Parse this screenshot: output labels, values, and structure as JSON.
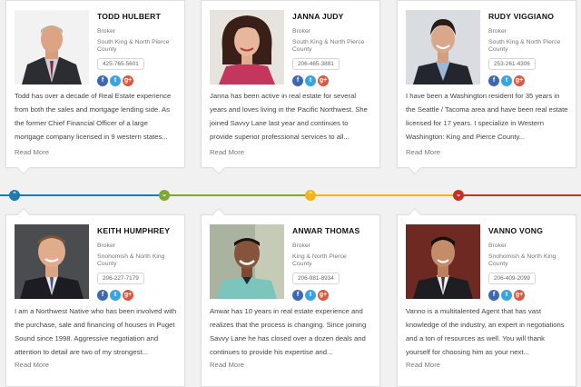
{
  "labels": {
    "read_more": "Read More",
    "fb": "f",
    "tw": "t",
    "gp": "g+"
  },
  "timeline": {
    "colors": {
      "blue": "#1f79b3",
      "green": "#7da933",
      "yellow": "#f3b51b",
      "red": "#c63026"
    },
    "icons": [
      "chevron-up-icon",
      "chevron-down-icon",
      "chevron-up-icon",
      "chevron-down-icon"
    ]
  },
  "agents": [
    {
      "name": "TODD HULBERT",
      "role": "Broker",
      "area": "South King & North Pierce County",
      "phone": "425-765-5601",
      "bio": "Todd has over a decade of Real Estate experience from both the sales and mortgage lending side. As the former Chief Financial Officer of a large mortgage company licensed in 9 western states..."
    },
    {
      "name": "JANNA JUDY",
      "role": "Broker",
      "area": "South King & North Pierce County",
      "phone": "206-465-3881",
      "bio": "Janna has been active in real estate for several years and loves living in the Pacific Northwest. She joined Savvy Lane last year and continues to provide superior professional services to all..."
    },
    {
      "name": "RUDY VIGGIANO",
      "role": "Broker",
      "area": "South King & North Pierce County",
      "phone": "253-261-4306",
      "bio": "I have been a Washington resident for 35 years in the Seattle / Tacoma area and have been real estate licensed for 17 years. I specialize in Western Washington: King and Pierce County..."
    },
    {
      "name": "KEITH HUMPHREY",
      "role": "Broker",
      "area": "Snohomish & North King County",
      "phone": "206-227-7179",
      "bio": "I am a Northwest Native who has been involved with the purchase, sale and financing of houses in Puget Sound since 1998. Aggressive negotiation and attention to detail are two of my strongest..."
    },
    {
      "name": "ANWAR THOMAS",
      "role": "Broker",
      "area": "King & North Pierce County",
      "phone": "206-981-8934",
      "bio": "Anwar has 10 years in real estate experience and realizes that the process is changing. Since joining Savvy Lane he has closed over a dozen deals and continues to provide his expertise and..."
    },
    {
      "name": "VANNO VONG",
      "role": "Broker",
      "area": "Snohomish & North King County",
      "phone": "206-409-2099",
      "bio": "Vanno is a multitalented Agent that has vast knowledge of the industry, an expert in negotiations and a ton of resources as well. You will thank yourself for choosing him as your next..."
    }
  ]
}
